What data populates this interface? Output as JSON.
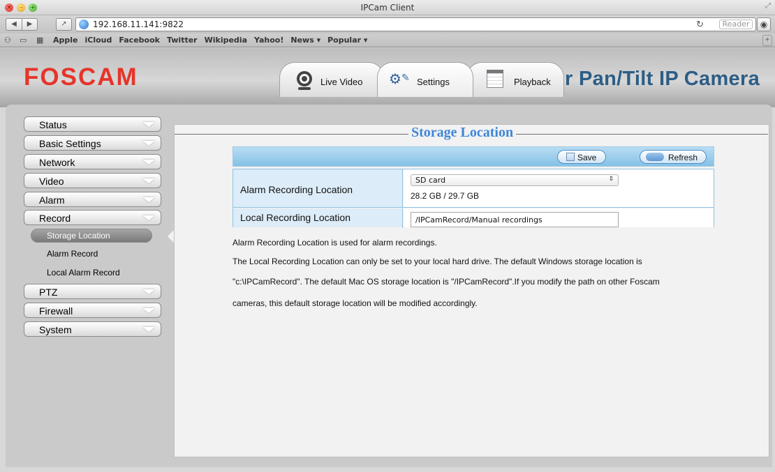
{
  "window": {
    "title": "IPCam Client"
  },
  "browser": {
    "url": "192.168.11.141:9822",
    "reader_label": "Reader",
    "bookmarks": [
      "Apple",
      "iCloud",
      "Facebook",
      "Twitter",
      "Wikipedia",
      "Yahoo!",
      "News ▾",
      "Popular ▾"
    ]
  },
  "header": {
    "brand": "FOSCAM",
    "camera_title": "or Pan/Tilt IP Camera",
    "tabs": [
      {
        "label": "Live Video"
      },
      {
        "label": "Settings"
      },
      {
        "label": "Playback"
      }
    ]
  },
  "sidebar": {
    "menu": [
      {
        "label": "Status"
      },
      {
        "label": "Basic Settings"
      },
      {
        "label": "Network"
      },
      {
        "label": "Video"
      },
      {
        "label": "Alarm"
      },
      {
        "label": "Record"
      },
      {
        "label": "PTZ"
      },
      {
        "label": "Firewall"
      },
      {
        "label": "System"
      }
    ],
    "record_sub": [
      {
        "label": "Storage Location"
      },
      {
        "label": "Alarm Record"
      },
      {
        "label": "Local Alarm Record"
      }
    ]
  },
  "page": {
    "title": "Storage Location",
    "save_label": "Save",
    "refresh_label": "Refresh",
    "alarm_location_label": "Alarm Recording Location",
    "alarm_location_value": "SD card",
    "capacity": "28.2 GB / 29.7 GB",
    "local_location_label": "Local Recording Location",
    "local_location_value": "/IPCamRecord/Manual recordings",
    "help": [
      "Alarm Recording Location is used for alarm recordings.",
      "The Local Recording Location can only be set to your local hard drive. The default Windows storage location is",
      "\"c:\\IPCamRecord\". The default Mac OS storage location is \"/IPCamRecord\".If you modify the path on other Foscam",
      "cameras, this default storage location will be modified accordingly."
    ]
  }
}
